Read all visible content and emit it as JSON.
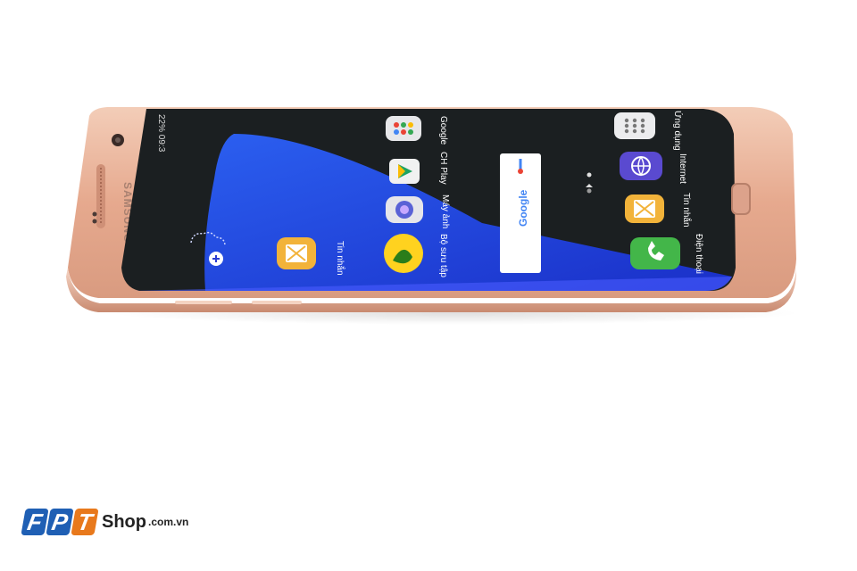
{
  "phone": {
    "brand": "SAMSUNG",
    "status_text": "22% 09:3",
    "apps": [
      {
        "label": "Tin nhắn",
        "icon": "messages-icon"
      },
      {
        "label": "Bộ sưu tập",
        "icon": "gallery-icon"
      },
      {
        "label": "Máy ảnh",
        "icon": "camera-icon"
      },
      {
        "label": "CH Play",
        "icon": "play-store-icon"
      },
      {
        "label": "Google",
        "icon": "google-folder-icon"
      },
      {
        "label": "Điện thoại",
        "icon": "phone-icon"
      },
      {
        "label": "Tin nhắn",
        "icon": "messages-icon"
      },
      {
        "label": "Internet",
        "icon": "internet-icon"
      },
      {
        "label": "Ứng dụng",
        "icon": "apps-icon"
      }
    ],
    "search_widget": {
      "text": "Google"
    },
    "colors": {
      "body": "#e9b49a",
      "screen": "#1b1f21",
      "wallpaper_blue": "#1e3fe0"
    }
  },
  "logo": {
    "letters": [
      "F",
      "P",
      "T"
    ],
    "shop": "Shop",
    "domain": ".com.vn"
  }
}
